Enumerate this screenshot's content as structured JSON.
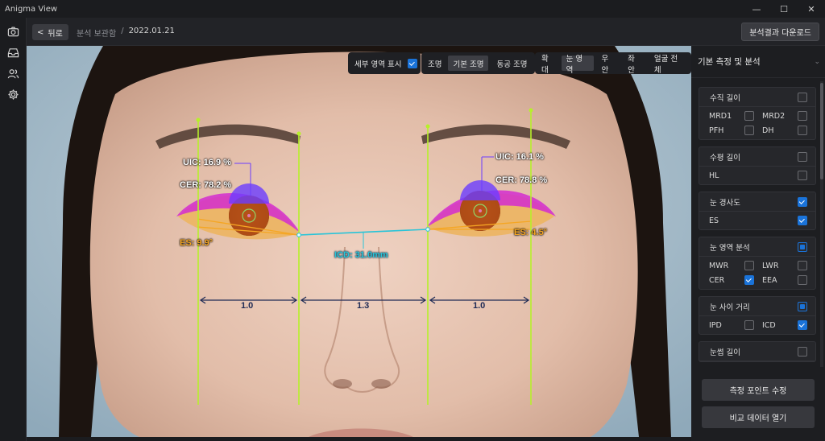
{
  "app": {
    "title": "Anigma View"
  },
  "window_controls": {
    "minimize": "—",
    "maximize": "☐",
    "close": "✕"
  },
  "rail": {
    "icons": [
      "camera-icon",
      "inbox-icon",
      "users-icon",
      "settings-icon"
    ]
  },
  "toolbar": {
    "back_label": "뒤로",
    "breadcrumb_root": "분석 보관함",
    "breadcrumb_sep": "/",
    "breadcrumb_current": "2022.01.21",
    "download_label": "분석결과 다운로드"
  },
  "viewer": {
    "detail_toggle": {
      "label": "세부 영역 표시",
      "checked": true
    },
    "lighting": {
      "label": "조명",
      "options": [
        "기본 조명",
        "동공 조명"
      ],
      "selected": "기본 조명"
    },
    "zoom": {
      "label": "확대",
      "options": [
        "눈 영역",
        "우안",
        "좌안",
        "얼굴 전체"
      ],
      "selected": "눈 영역"
    },
    "annotations": {
      "right_eye_uic": "UIC: 16.9 %",
      "right_eye_cer": "CER: 78.2 %",
      "right_eye_es": "ES: 9.9°",
      "left_eye_uic": "UIC: 16.1 %",
      "left_eye_cer": "CER: 78.8 %",
      "left_eye_es": "ES: 4.5°",
      "icd": "ICD: 31.0mm",
      "ratio_left": "1.0",
      "ratio_mid": "1.3",
      "ratio_right": "1.0"
    },
    "colors": {
      "guide": "#b6f02a",
      "icd": "#28c4d8",
      "uic": "#6b3cff",
      "cer": "#e0601a",
      "es": "#f5a623",
      "lid": "#d42bd0"
    }
  },
  "panel": {
    "title": "기본 측정 및 분석",
    "cards": [
      {
        "title": "수직 길이",
        "state": "off",
        "items": [
          {
            "label": "MRD1",
            "checked": false
          },
          {
            "label": "MRD2",
            "checked": false
          },
          {
            "label": "PFH",
            "checked": false
          },
          {
            "label": "DH",
            "checked": false
          }
        ]
      },
      {
        "title": "수평 길이",
        "state": "off",
        "items": [
          {
            "label": "HL",
            "checked": false
          }
        ]
      },
      {
        "title": "눈 경사도",
        "state": "on",
        "items": [
          {
            "label": "ES",
            "checked": true
          }
        ]
      },
      {
        "title": "눈 영역 분석",
        "state": "partial",
        "items": [
          {
            "label": "MWR",
            "checked": false
          },
          {
            "label": "LWR",
            "checked": false
          },
          {
            "label": "CER",
            "checked": true
          },
          {
            "label": "EEA",
            "checked": false
          }
        ]
      },
      {
        "title": "눈 사이 거리",
        "state": "partial",
        "items": [
          {
            "label": "IPD",
            "checked": false
          },
          {
            "label": "ICD",
            "checked": true
          }
        ]
      },
      {
        "title": "눈썹 길이",
        "state": "off",
        "items": []
      }
    ],
    "edit_points_label": "측정 포인트 수정",
    "compare_label": "비교 데이터 열기"
  }
}
